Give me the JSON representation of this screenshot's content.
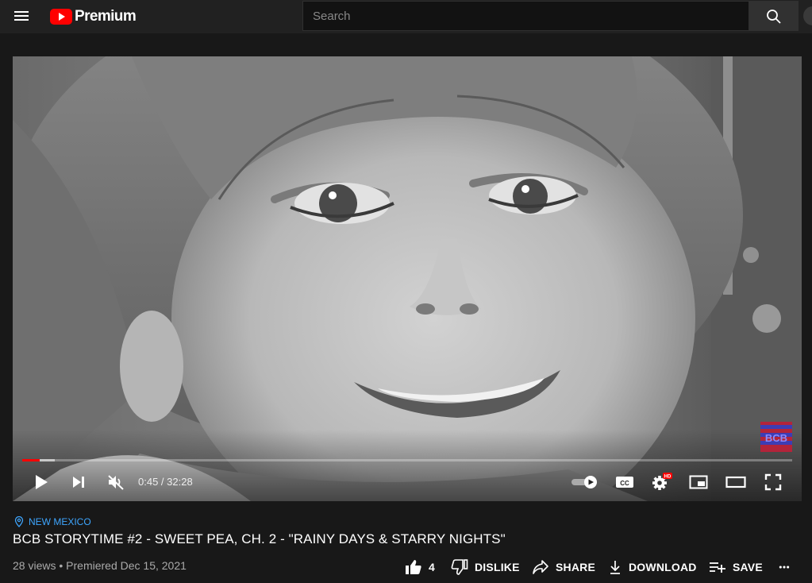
{
  "header": {
    "logo_text": "Premium",
    "search_placeholder": "Search"
  },
  "player": {
    "current_time": "0:45",
    "duration": "32:28",
    "progress": 0.023,
    "buffered": 0.042,
    "watermark_text": "BCB",
    "settings_badge": "HD"
  },
  "video": {
    "location": "NEW MEXICO",
    "title": "BCB STORYTIME #2 - SWEET PEA, CH. 2 - \"RAINY DAYS & STARRY NIGHTS\"",
    "views": "28 views",
    "separator": "•",
    "premiered": "Premiered Dec 15, 2021"
  },
  "actions": {
    "like_count": "4",
    "dislike_label": "DISLIKE",
    "share_label": "SHARE",
    "download_label": "DOWNLOAD",
    "save_label": "SAVE"
  },
  "colors": {
    "accent_red": "#ff0000",
    "link_blue": "#3ea6ff",
    "background": "#181818",
    "masthead": "#212121"
  }
}
